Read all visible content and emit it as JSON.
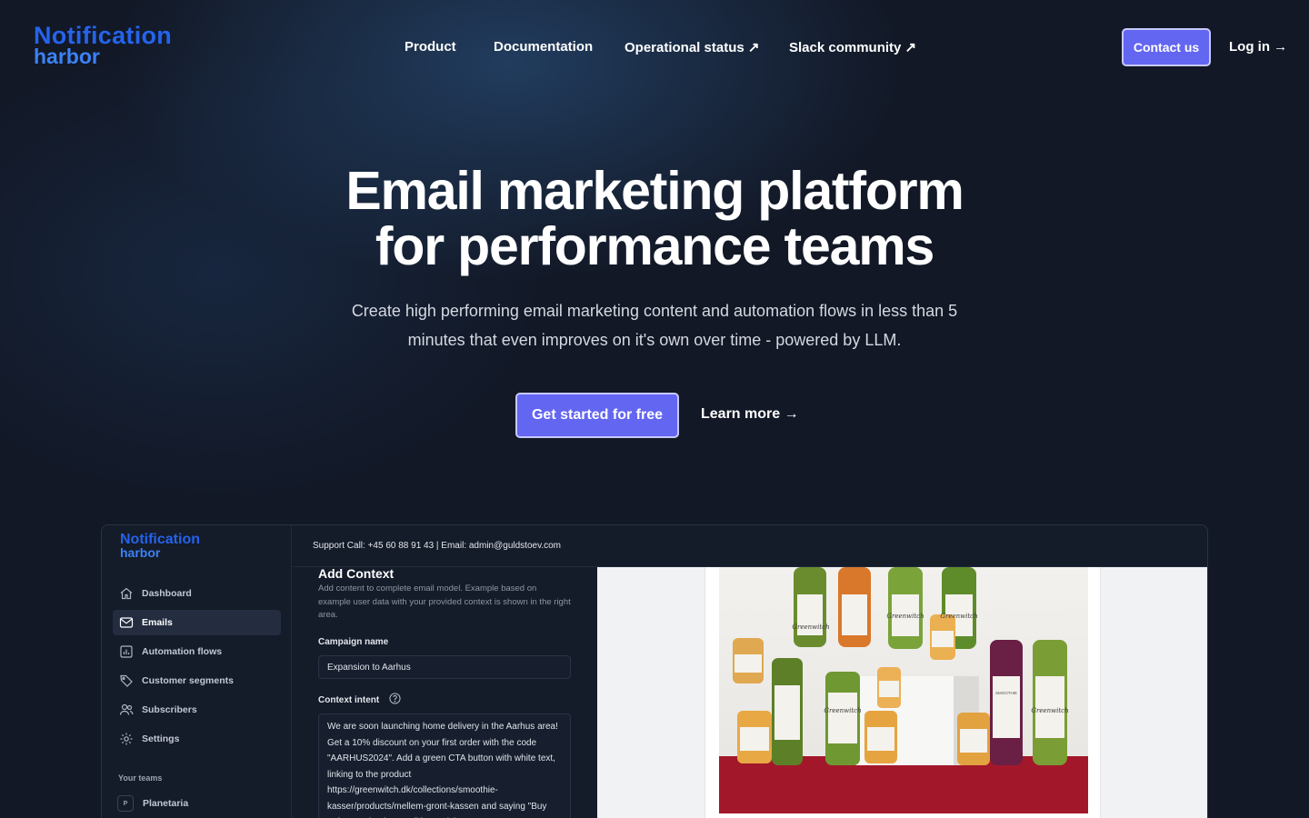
{
  "brand": {
    "line1": "Notification",
    "line2": "harbor"
  },
  "nav": {
    "links": [
      "Product",
      "Documentation",
      "Operational status ↗",
      "Slack community ↗"
    ],
    "contact": "Contact us",
    "login": "Log in →"
  },
  "hero": {
    "title_line1": "Email marketing platform",
    "title_line2": "for performance teams",
    "subtitle": "Create high performing email marketing content and automation flows in less than 5 minutes that even improves on it's own over time - powered by LLM.",
    "primary_cta": "Get started for free",
    "secondary_cta": "Learn more →"
  },
  "app": {
    "brand": {
      "line1": "Notification",
      "line2": "harbor"
    },
    "sidebar": {
      "items": [
        {
          "label": "Dashboard",
          "icon": "home-icon"
        },
        {
          "label": "Emails",
          "icon": "mail-icon",
          "active": true
        },
        {
          "label": "Automation flows",
          "icon": "chart-icon"
        },
        {
          "label": "Customer segments",
          "icon": "tag-icon"
        },
        {
          "label": "Subscribers",
          "icon": "users-icon"
        },
        {
          "label": "Settings",
          "icon": "gear-icon"
        }
      ],
      "teams_label": "Your teams",
      "team": {
        "initial": "P",
        "name": "Planetaria"
      }
    },
    "topbar": "Support Call: +45 60 88 91 43 | Email: admin@guldstoev.com",
    "form": {
      "heading": "Add Context",
      "description": "Add content to complete email model. Example based on example user data with your provided context is shown in the right area.",
      "campaign_label": "Campaign name",
      "campaign_value": "Expansion to Aarhus",
      "intent_label": "Context intent",
      "intent_value": "We are soon launching home delivery in the Aarhus area! Get a 10% discount on your first order with the code \"AARHUS2024\". Add a green CTA button with white text, linking to the product https://greenwitch.dk/collections/smoothie-kasser/products/mellem-gront-kassen and saying \"Buy today\". Write the email in Danish."
    },
    "product_labels": [
      "Greenwitch",
      "SMOOTHIE"
    ]
  },
  "colors": {
    "background": "#121826",
    "accent": "#6366f1",
    "brand_blue": "#2563eb"
  }
}
